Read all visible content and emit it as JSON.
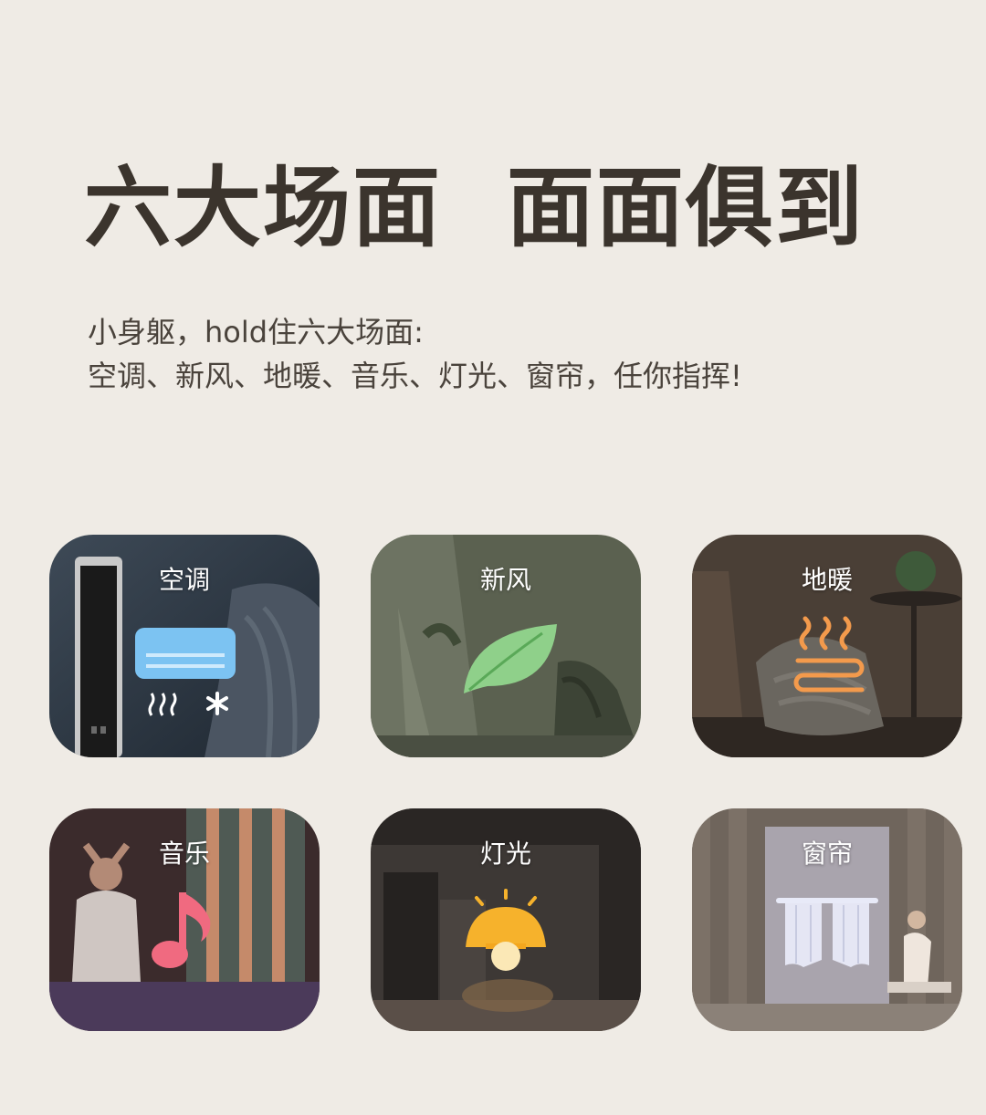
{
  "headline": "六大场面  面面俱到",
  "subtitle": {
    "line1": "小身躯，hold住六大场面:",
    "line2": "空调、新风、地暖、音乐、灯光、窗帘，任你指挥!"
  },
  "scenes": [
    {
      "label": "空调",
      "icon": "air-conditioner-icon"
    },
    {
      "label": "新风",
      "icon": "leaf-icon"
    },
    {
      "label": "地暖",
      "icon": "floor-heating-icon"
    },
    {
      "label": "音乐",
      "icon": "music-note-icon"
    },
    {
      "label": "灯光",
      "icon": "lamp-icon"
    },
    {
      "label": "窗帘",
      "icon": "curtain-icon"
    }
  ],
  "colors": {
    "background": "#efebe5",
    "headline": "#3b342d",
    "ac_icon": "#7cc3f2",
    "leaf_icon": "#8fd08a",
    "heating_icon": "#f39a4c",
    "music_icon": "#f06a80",
    "lamp_icon": "#f6b22c",
    "curtain_icon": "#e8eaf8"
  }
}
